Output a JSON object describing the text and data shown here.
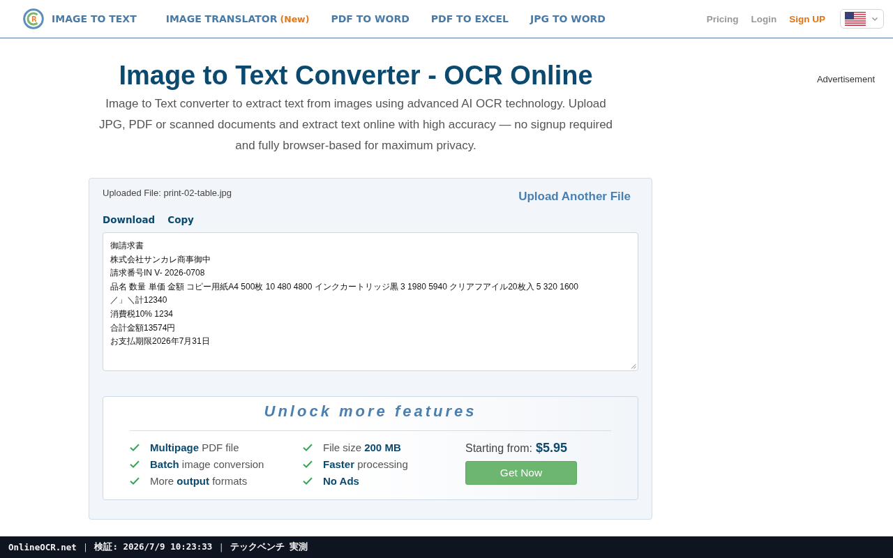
{
  "header": {
    "logo_letter": "R",
    "brand": "IMAGE TO TEXT",
    "nav": [
      {
        "label": "IMAGE TRANSLATOR",
        "badge": "(New)"
      },
      {
        "label": "PDF TO WORD"
      },
      {
        "label": "PDF TO EXCEL"
      },
      {
        "label": "JPG TO WORD"
      }
    ],
    "account_links": [
      {
        "label": "Pricing",
        "kind": "muted"
      },
      {
        "label": "Login",
        "kind": "muted"
      },
      {
        "label": "Sign UP",
        "kind": "accent"
      }
    ]
  },
  "hero": {
    "title": "Image to Text Converter - OCR Online",
    "description": "Image to Text converter to extract text from images using advanced AI OCR technology. Upload JPG, PDF or scanned documents and extract text online with high accuracy — no signup required and fully browser-based for maximum privacy."
  },
  "sidebar": {
    "ad_label": "Advertisement"
  },
  "result": {
    "uploaded_file": "Uploaded File: print-02-table.jpg",
    "upload_another": "Upload Another File",
    "actions": [
      "Download",
      "Copy"
    ],
    "output_lines": [
      "御請求書",
      "株式会社サンカレ商事御中",
      "請求番号IN V- 2026-0708",
      "品名 数量 単価 金額 コピー用紙A4 500枚 10 480 4800 インクカートリッジ黒 3 1980 5940 クリアフアイル20枚入 5 320 1600",
      "／」＼計12340",
      "消費税10% 1234",
      "合計金額13574円",
      "お支払期限2026年7月31日"
    ]
  },
  "upgrade": {
    "title": "Unlock more features",
    "feature_columns": [
      [
        {
          "text": "**Multipage** PDF file",
          "emphasis": false
        },
        {
          "text": "**Batch** image conversion",
          "emphasis": false
        },
        {
          "text": "More **output** formats",
          "emphasis": false
        }
      ],
      [
        {
          "text": "File size **200 MB**",
          "emphasis": false
        },
        {
          "text": "**Faster** processing",
          "emphasis": false
        },
        {
          "text": "No Ads",
          "emphasis": true
        }
      ]
    ],
    "price_label": "Starting from:",
    "price": "$5.95",
    "button": "Get Now"
  },
  "status_bar": {
    "items": [
      {
        "kind": "text",
        "text": "OnlineOCR.net"
      },
      {
        "kind": "separator",
        "text": "|"
      },
      {
        "kind": "text",
        "text": "検証: 2026/7/9 10:23:33"
      },
      {
        "kind": "separator",
        "text": "|"
      },
      {
        "kind": "text",
        "text": "テックベンチ 実測"
      }
    ]
  }
}
